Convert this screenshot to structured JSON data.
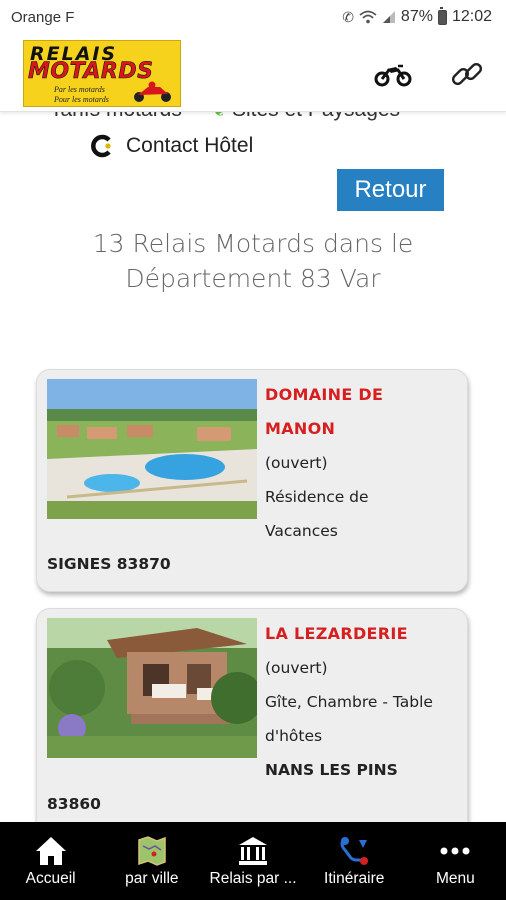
{
  "status_bar": {
    "carrier": "Orange F",
    "battery": "87%",
    "time": "12:02"
  },
  "header": {
    "logo": {
      "line1": "RELAIS",
      "line2": "MOTARDS",
      "tagline1": "Par les motards",
      "tagline2": "Pour les motards"
    },
    "icons": [
      "motorcycle-icon",
      "link-icon"
    ]
  },
  "top_links": {
    "tarifs": "Tarifs motards",
    "sites": "Sites et Paysages",
    "contact": "Contact Hôtel"
  },
  "retour_label": "Retour",
  "count_title": "13 Relais Motards dans le Département 83 Var",
  "listings": [
    {
      "name_line1": "DOMAINE DE",
      "name_line2": "MANON",
      "status": "(ouvert)",
      "type_line1": "Résidence de",
      "type_line2": "Vacances",
      "location": "SIGNES 83870"
    },
    {
      "name_line1": "LA LEZARDERIE",
      "status": "(ouvert)",
      "type_line1": "Gîte, Chambre - Table",
      "type_line2": "d'hôtes",
      "location_line1": "NANS LES PINS",
      "location_line2": "83860"
    }
  ],
  "bottom_nav": [
    {
      "label": "Accueil",
      "icon": "home-icon"
    },
    {
      "label": "par ville",
      "icon": "map-icon"
    },
    {
      "label": "Relais par ...",
      "icon": "building-icon"
    },
    {
      "label": "Itinéraire",
      "icon": "route-icon"
    },
    {
      "label": "Menu",
      "icon": "more-dots-icon"
    }
  ],
  "colors": {
    "accent_blue": "#2680c2",
    "listing_red": "#d62020",
    "logo_yellow": "#f7d21c",
    "nav_bg": "#000000"
  }
}
